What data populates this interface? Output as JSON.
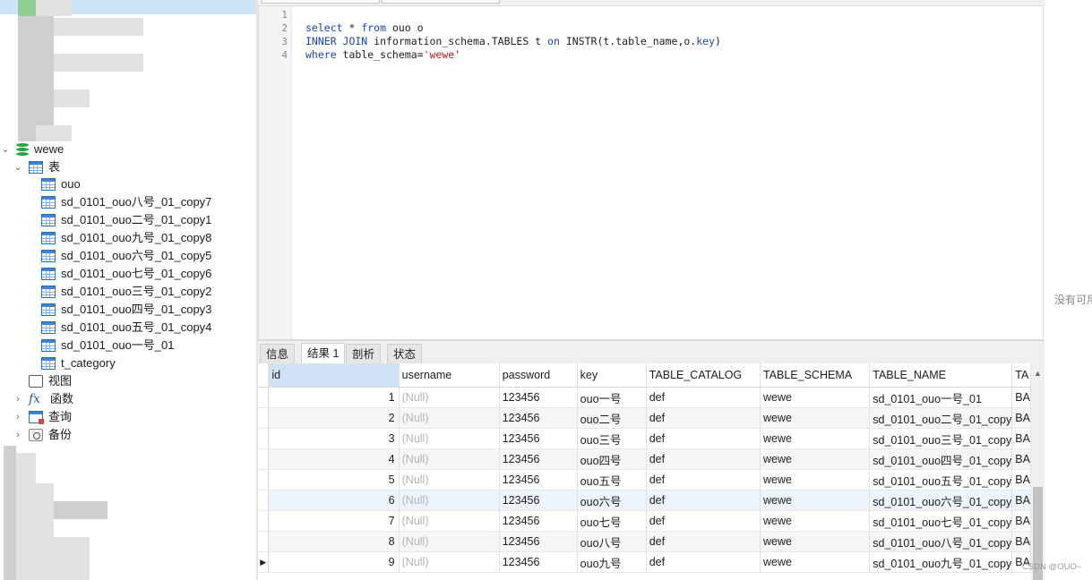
{
  "navigator": {
    "database": "wewe",
    "tables_group": "表",
    "tables": [
      "ouo",
      "sd_0101_ouo八号_01_copy7",
      "sd_0101_ouo二号_01_copy1",
      "sd_0101_ouo九号_01_copy8",
      "sd_0101_ouo六号_01_copy5",
      "sd_0101_ouo七号_01_copy6",
      "sd_0101_ouo三号_01_copy2",
      "sd_0101_ouo四号_01_copy3",
      "sd_0101_ouo五号_01_copy4",
      "sd_0101_ouo一号_01",
      "t_category"
    ],
    "views": "视图",
    "functions": "函数",
    "queries": "查询",
    "backups": "备份"
  },
  "editor": {
    "line_numbers": [
      "1",
      "2",
      "3",
      "4"
    ],
    "line2": {
      "kw1": "select",
      "t1": " * ",
      "kw2": "from",
      "t2": " ouo o"
    },
    "line3": {
      "kw1": "INNER JOIN",
      "t1": " information_schema.TABLES t ",
      "kw2": "on",
      "t2": " INSTR(t.table_name,o.",
      "kw3": "key",
      "t3": ")"
    },
    "line4": {
      "kw1": "where",
      "t1": " table_schema=",
      "str": "'wewe'"
    }
  },
  "right_note": "没有可用",
  "result_tabs": [
    "信息",
    "结果 1",
    "剖析",
    "状态"
  ],
  "grid": {
    "columns": [
      "id",
      "username",
      "password",
      "key",
      "TABLE_CATALOG",
      "TABLE_SCHEMA",
      "TABLE_NAME",
      "TA"
    ],
    "rows": [
      [
        "1",
        "(Null)",
        "123456",
        "ouo一号",
        "def",
        "wewe",
        "sd_0101_ouo一号_01",
        "BA"
      ],
      [
        "2",
        "(Null)",
        "123456",
        "ouo二号",
        "def",
        "wewe",
        "sd_0101_ouo二号_01_copy",
        "BA"
      ],
      [
        "3",
        "(Null)",
        "123456",
        "ouo三号",
        "def",
        "wewe",
        "sd_0101_ouo三号_01_copy",
        "BA"
      ],
      [
        "4",
        "(Null)",
        "123456",
        "ouo四号",
        "def",
        "wewe",
        "sd_0101_ouo四号_01_copy",
        "BA"
      ],
      [
        "5",
        "(Null)",
        "123456",
        "ouo五号",
        "def",
        "wewe",
        "sd_0101_ouo五号_01_copy",
        "BA"
      ],
      [
        "6",
        "(Null)",
        "123456",
        "ouo六号",
        "def",
        "wewe",
        "sd_0101_ouo六号_01_copy",
        "BA"
      ],
      [
        "7",
        "(Null)",
        "123456",
        "ouo七号",
        "def",
        "wewe",
        "sd_0101_ouo七号_01_copy",
        "BA"
      ],
      [
        "8",
        "(Null)",
        "123456",
        "ouo八号",
        "def",
        "wewe",
        "sd_0101_ouo八号_01_copy",
        "BA"
      ],
      [
        "9",
        "(Null)",
        "123456",
        "ouo九号",
        "def",
        "wewe",
        "sd_0101_ouo九号_01_copy",
        "BA"
      ]
    ],
    "current_row_marker": "▶"
  },
  "watermark": "CSDN @OUO~"
}
